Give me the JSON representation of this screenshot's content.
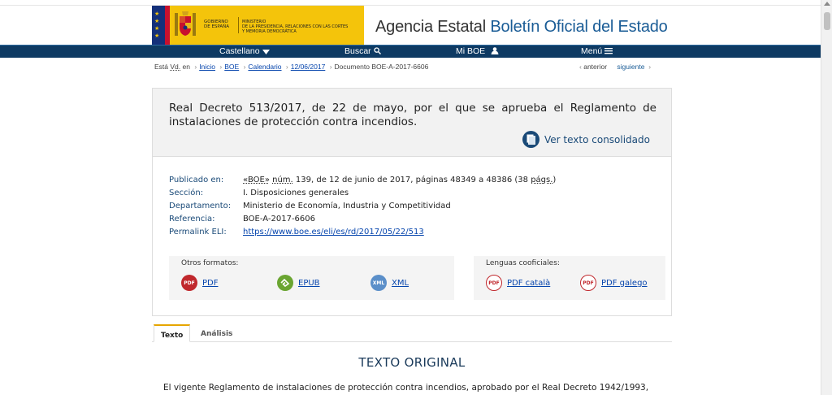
{
  "header": {
    "gov_line1": "GOBIERNO",
    "gov_line2": "DE ESPAÑA",
    "ministry_line1": "MINISTERIO",
    "ministry_line2": "DE LA PRESIDENCIA, RELACIONES CON LAS CORTES",
    "ministry_line3": "Y MEMORIA DEMOCRÁTICA",
    "site_title_plain": "Agencia Estatal ",
    "site_title_highlight": "Boletín Oficial del Estado"
  },
  "nav": {
    "language": "Castellano",
    "search": "Buscar",
    "my_boe": "Mi BOE",
    "menu": "Menú"
  },
  "breadcrumb": {
    "prefix_1": "Está ",
    "prefix_abbr": "Vd.",
    "prefix_2": " en",
    "items": [
      "Inicio",
      "BOE",
      "Calendario",
      "12/06/2017"
    ],
    "current": "Documento BOE-A-2017-6606"
  },
  "pager": {
    "previous": "anterior",
    "next": "siguiente"
  },
  "document": {
    "title": "Real Decreto 513/2017, de 22 de mayo, por el que se aprueba el Reglamento de instalaciones de protección contra incendios.",
    "consolidated_label": "Ver texto consolidado",
    "meta": {
      "published_key": "Publicado en:",
      "published_boe": "«BOE»",
      "published_num_abbr": "núm.",
      "published_rest": " 139, de 12 de junio de 2017, páginas 48349 a 48386 (38 ",
      "published_pags": "págs.",
      "published_close": ")",
      "section_key": "Sección:",
      "section_val": "I. Disposiciones generales",
      "department_key": "Departamento:",
      "department_val": "Ministerio de Economía, Industria y Competitividad",
      "reference_key": "Referencia:",
      "reference_val": "BOE-A-2017-6606",
      "eli_key": "Permalink ELI:",
      "eli_val": "https://www.boe.es/eli/es/rd/2017/05/22/513"
    },
    "other_formats": {
      "title": "Otros formatos:",
      "items": [
        "PDF",
        "EPUB",
        "XML"
      ]
    },
    "co_languages": {
      "title": "Lenguas cooficiales:",
      "items": [
        "PDF català",
        "PDF galego"
      ]
    }
  },
  "tabs": [
    "Texto",
    "Análisis"
  ],
  "content": {
    "heading": "TEXTO ORIGINAL",
    "first_paragraph": "El vigente Reglamento de instalaciones de protección contra incendios, aprobado por el Real Decreto 1942/1993,"
  },
  "colors": {
    "navbar": "#0e3a63",
    "gov_yellow": "#f4c40b",
    "accent_blue": "#1a5c96",
    "link": "#0645ad",
    "pdf_red": "#c0282d",
    "epub_green": "#6aa531",
    "xml_blue": "#5b8fc9"
  }
}
